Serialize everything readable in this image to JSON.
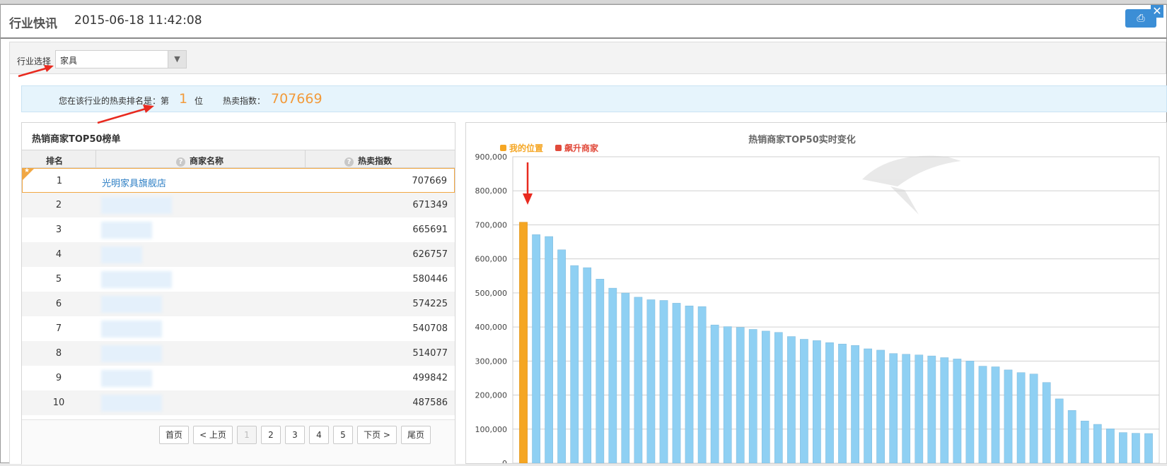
{
  "dialog": {
    "title": "行业快讯",
    "timestamp": "2015-06-18 11:42:08",
    "print_icon": "printer-icon",
    "close_icon": "close-icon"
  },
  "filter": {
    "label": "行业选择",
    "selected": "家具"
  },
  "rank_info": {
    "prefix": "您在该行业的热卖排名是：第",
    "rank": "1",
    "unit": "位",
    "index_label": "热卖指数：",
    "index_value": "707669"
  },
  "table": {
    "title": "热销商家TOP50榜单",
    "columns": [
      "排名",
      "商家名称",
      "热卖指数"
    ],
    "rows": [
      {
        "rank": "1",
        "name": "光明家具旗舰店",
        "value": "707669"
      },
      {
        "rank": "2",
        "name": "",
        "value": "671349"
      },
      {
        "rank": "3",
        "name": "",
        "value": "665691"
      },
      {
        "rank": "4",
        "name": "",
        "value": "626757"
      },
      {
        "rank": "5",
        "name": "",
        "value": "580446"
      },
      {
        "rank": "6",
        "name": "",
        "value": "574225"
      },
      {
        "rank": "7",
        "name": "",
        "value": "540708"
      },
      {
        "rank": "8",
        "name": "",
        "value": "514077"
      },
      {
        "rank": "9",
        "name": "",
        "value": "499842"
      },
      {
        "rank": "10",
        "name": "",
        "value": "487586"
      }
    ]
  },
  "pager": {
    "first": "首页",
    "prev": "< 上页",
    "pages": [
      "1",
      "2",
      "3",
      "4",
      "5"
    ],
    "next": "下页 >",
    "last": "尾页"
  },
  "colors": {
    "accent_orange": "#f29a3a",
    "my_bar": "#f5a623",
    "other_bar": "#8fd0f3",
    "rising": "#e14a3b",
    "link_blue": "#2b7ec4"
  },
  "chart_data": {
    "type": "bar",
    "title": "热销商家TOP50实时变化",
    "legend": [
      {
        "name": "我的位置",
        "color": "#f5a623"
      },
      {
        "name": "飙升商家",
        "color": "#e14a3b"
      }
    ],
    "legend_placement": "top-left",
    "ylim": [
      0,
      900000
    ],
    "yticks": [
      "0",
      "100,000",
      "200,000",
      "300,000",
      "400,000",
      "500,000",
      "600,000",
      "700,000",
      "800,000",
      "900,000"
    ],
    "grid": true,
    "my_index": 0,
    "values": [
      707669,
      671349,
      665691,
      626757,
      580446,
      574225,
      540708,
      514077,
      499842,
      487586,
      480000,
      478000,
      470000,
      462000,
      460000,
      406000,
      401000,
      399000,
      393000,
      388000,
      384000,
      372000,
      364000,
      360000,
      354000,
      350000,
      346000,
      336000,
      332000,
      322000,
      320000,
      318000,
      315000,
      310000,
      306000,
      300000,
      285000,
      283000,
      274000,
      266000,
      262000,
      237000,
      189000,
      155000,
      124000,
      114000,
      101000,
      90000,
      88000,
      87000
    ]
  }
}
